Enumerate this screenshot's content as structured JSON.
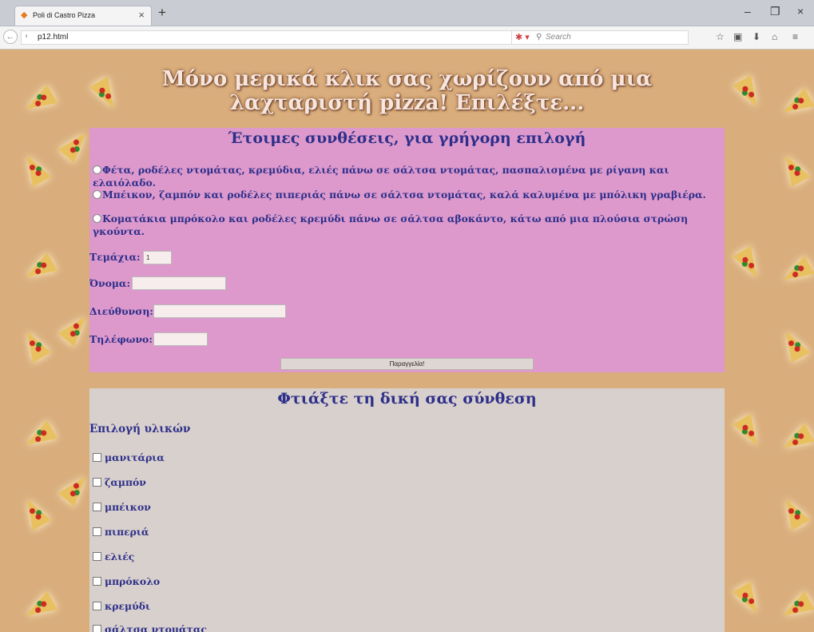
{
  "browser": {
    "tab_title": "Poli di Castro Pizza",
    "url": "p12.html",
    "search_placeholder": "Search"
  },
  "page": {
    "main_heading": "Μόνο μερικά κλικ σας χωρίζουν από μια λαχταριστή pizza! Επιλέξτε...",
    "ready": {
      "heading": "Έτοιμες συνθέσεις, για γρήγορη επιλογή",
      "options": [
        "Φέτα, ροδέλες ντομάτας, κρεμύδια, ελιές πάνω σε σάλτσα ντομάτας, πασπαλισμένα με ρίγανη και ελαιόλαδο.",
        "Μπέικον, ζαμπόν και ροδέλες πιπεριάς πάνω σε σάλτσα ντομάτας, καλά καλυμένα με μπόλικη γραβιέρα.",
        "Κοματάκια μπρόκολο και ροδέλες κρεμύδι πάνω σε σάλτσα αβοκάντο, κάτω από μια πλούσια στρώση γκούντα."
      ],
      "pieces_label": "Τεμάχια:",
      "pieces_value": "1",
      "name_label": "Όνομα:",
      "address_label": "Διεύθυνση:",
      "phone_label": "Τηλέφωνο:",
      "order_button": "Παραγγελία!"
    },
    "custom": {
      "heading": "Φτιάξτε τη δική σας σύνθεση",
      "ingredients_heading": "Επιλογή υλικών",
      "ingredients": [
        "μανιτάρια",
        "ζαμπόν",
        "μπέικον",
        "πιπεριά",
        "ελιές",
        "μπρόκολο",
        "κρεμύδι",
        "σάλτσα ντομάτας"
      ]
    }
  }
}
